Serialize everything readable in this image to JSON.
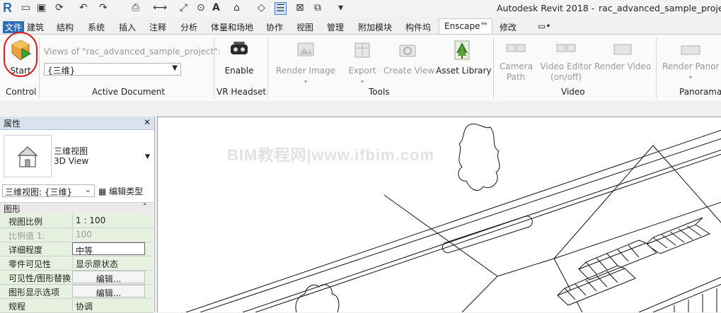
{
  "titlebar": {
    "app": "Autodesk Revit 2018 -",
    "project": "rac_advanced_sample_project"
  },
  "tabs": [
    "文件",
    "建筑",
    "结构",
    "系统",
    "插入",
    "注释",
    "分析",
    "体量和场地",
    "协作",
    "视图",
    "管理",
    "附加模块",
    "构件坞",
    "Enscape™",
    "修改",
    "▭•"
  ],
  "ribbon": {
    "start": "Start",
    "views_label": "Views of \"rac_advanced_sample_project\":",
    "views_value": "{三维}",
    "enable": "Enable",
    "render_image": "Render Image",
    "export": "Export",
    "create_view": "Create View",
    "asset_library": "Asset Library",
    "camera_path_1": "Camera",
    "camera_path_2": "Path",
    "video_editor_1": "Video Editor",
    "video_editor_2": "(on/off)",
    "render_video": "Render Video",
    "render_panorama": "Render Panora",
    "panels": {
      "control": "Control",
      "active_document": "Active Document",
      "vr_headset": "VR Headset",
      "tools": "Tools",
      "video": "Video",
      "panorama": "Panorama"
    }
  },
  "properties": {
    "title": "属性",
    "type_cn": "三维视图",
    "type_en": "3D View",
    "instance": "三维视图: {三维}",
    "edit_type": "编辑类型",
    "group": "图形",
    "rows": [
      {
        "key": "视图比例",
        "value": "1 : 100"
      },
      {
        "key": "比例值 1:",
        "value": "100"
      },
      {
        "key": "详细程度",
        "value": "中等"
      },
      {
        "key": "零件可见性",
        "value": "显示原状态"
      },
      {
        "key": "可见性/图形替换",
        "value": "编辑..."
      },
      {
        "key": "图形显示选项",
        "value": "编辑..."
      },
      {
        "key": "规程",
        "value": "协调"
      }
    ]
  },
  "canvas": {
    "watermark": "BIM教程网|www.ifbim.com"
  },
  "colors": {
    "accent": "#2d6db5",
    "highlight": "#d92020",
    "row_bg": "#e6f1e0"
  }
}
